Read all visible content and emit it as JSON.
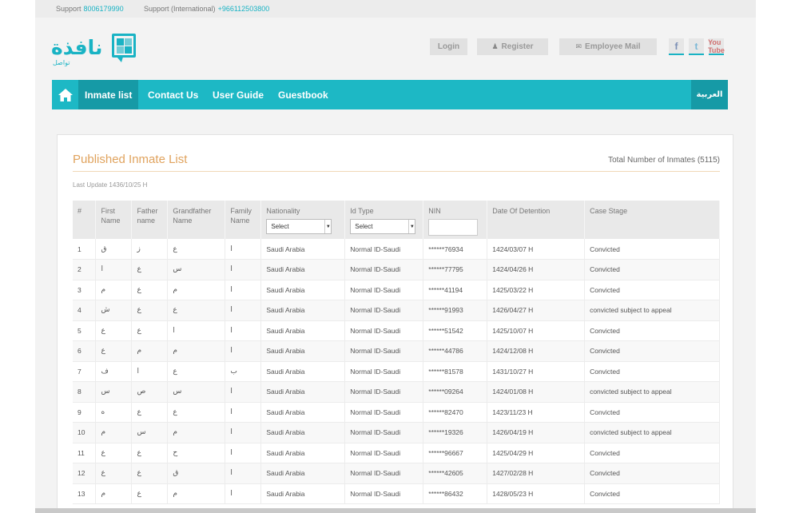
{
  "support": {
    "label": "Support",
    "number": "8006179990",
    "intl_label": "Support (International)",
    "intl_number": "+966112503800"
  },
  "logo": {
    "arabic": "نافذة",
    "sub": "تواصل"
  },
  "header": {
    "login": "Login",
    "register": "Register",
    "employee_mail": "Employee Mail",
    "social": [
      "f",
      "t",
      "You Tube"
    ]
  },
  "nav": {
    "items": [
      "Inmate list",
      "Contact Us",
      "User Guide",
      "Guestbook"
    ],
    "lang": "العربية"
  },
  "main": {
    "title": "Published Inmate List",
    "total": "Total Number of Inmates (5115)",
    "last_update": "Last Update 1436/10/25 H"
  },
  "table": {
    "headers": {
      "num": "#",
      "first": "First Name",
      "father": "Father name",
      "grandfather": "Grandfather Name",
      "family": "Family Name",
      "nationality": "Nationality",
      "idtype": "Id Type",
      "nin": "NIN",
      "detention": "Date Of Detention",
      "stage": "Case Stage"
    },
    "select_label": "Select",
    "rows": [
      [
        "1",
        "ق",
        "ز",
        "ع",
        "ا",
        "Saudi Arabia",
        "Normal ID-Saudi",
        "******76934",
        "1424/03/07 H",
        "Convicted"
      ],
      [
        "2",
        "ا",
        "ع",
        "س",
        "ا",
        "Saudi Arabia",
        "Normal ID-Saudi",
        "******77795",
        "1424/04/26 H",
        "Convicted"
      ],
      [
        "3",
        "م",
        "ع",
        "م",
        "ا",
        "Saudi Arabia",
        "Normal ID-Saudi",
        "******41194",
        "1425/03/22 H",
        "Convicted"
      ],
      [
        "4",
        "ش",
        "ع",
        "ع",
        "ا",
        "Saudi Arabia",
        "Normal ID-Saudi",
        "******91993",
        "1426/04/27 H",
        "convicted subject to appeal"
      ],
      [
        "5",
        "ع",
        "ع",
        "ا",
        "ا",
        "Saudi Arabia",
        "Normal ID-Saudi",
        "******51542",
        "1425/10/07 H",
        "Convicted"
      ],
      [
        "6",
        "ع",
        "م",
        "م",
        "ا",
        "Saudi Arabia",
        "Normal ID-Saudi",
        "******44786",
        "1424/12/08 H",
        "Convicted"
      ],
      [
        "7",
        "ف",
        "ا",
        "ع",
        "ب",
        "Saudi Arabia",
        "Normal ID-Saudi",
        "******81578",
        "1431/10/27 H",
        "Convicted"
      ],
      [
        "8",
        "س",
        "ص",
        "س",
        "ا",
        "Saudi Arabia",
        "Normal ID-Saudi",
        "******09264",
        "1424/01/08 H",
        "convicted subject to appeal"
      ],
      [
        "9",
        "ه",
        "ع",
        "ع",
        "ا",
        "Saudi Arabia",
        "Normal ID-Saudi",
        "******82470",
        "1423/11/23 H",
        "Convicted"
      ],
      [
        "10",
        "م",
        "س",
        "م",
        "ا",
        "Saudi Arabia",
        "Normal ID-Saudi",
        "******19326",
        "1426/04/19 H",
        "convicted subject to appeal"
      ],
      [
        "11",
        "ع",
        "ع",
        "ح",
        "ا",
        "Saudi Arabia",
        "Normal ID-Saudi",
        "******96667",
        "1425/04/29 H",
        "Convicted"
      ],
      [
        "12",
        "ع",
        "ع",
        "ق",
        "ا",
        "Saudi Arabia",
        "Normal ID-Saudi",
        "******42605",
        "1427/02/28 H",
        "Convicted"
      ],
      [
        "13",
        "م",
        "ع",
        "م",
        "ا",
        "Saudi Arabia",
        "Normal ID-Saudi",
        "******86432",
        "1428/05/23 H",
        "Convicted"
      ]
    ]
  },
  "colors": {
    "accent": "#1db8c5",
    "accent_dark": "#169aa6",
    "title": "#e0a35e"
  }
}
